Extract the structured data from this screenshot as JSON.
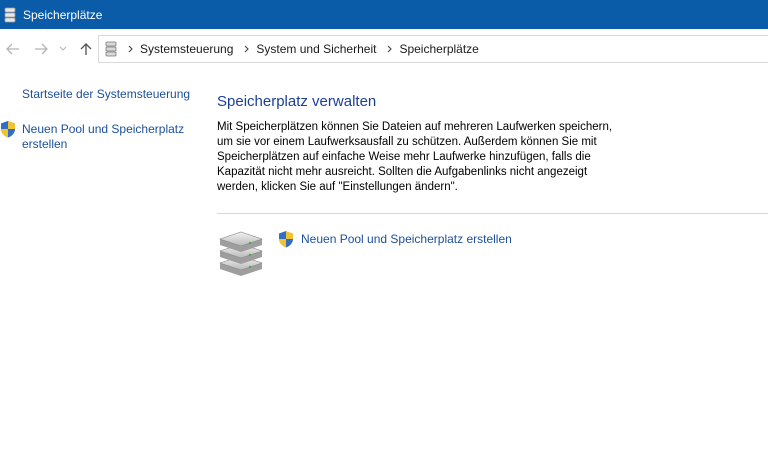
{
  "window": {
    "title": "Speicherplätze",
    "icon": "storage-spaces-icon"
  },
  "address": {
    "breadcrumbs": [
      "Systemsteuerung",
      "System und Sicherheit",
      "Speicherplätze"
    ]
  },
  "sidebar": {
    "home_link": "Startseite der Systemsteuerung",
    "create_pool_link_line1": "Neuen Pool und Speicherplatz",
    "create_pool_link_line2": "erstellen"
  },
  "main": {
    "heading": "Speicherplatz verwalten",
    "description": "Mit Speicherplätzen können Sie Dateien auf mehreren Laufwerken speichern, um sie vor einem Laufwerksausfall zu schützen. Außerdem können Sie mit Speicherplätzen auf einfache Weise mehr Laufwerke hinzufügen, falls die Kapazität nicht mehr ausreicht. Sollten die Aufgabenlinks nicht angezeigt werden, klicken Sie auf \"Einstellungen ändern\".",
    "create_pool_label": "Neuen Pool und Speicherplatz erstellen"
  },
  "colors": {
    "titlebar": "#0a5ba8",
    "link": "#1c4f9c",
    "heading": "#1c3f96"
  }
}
